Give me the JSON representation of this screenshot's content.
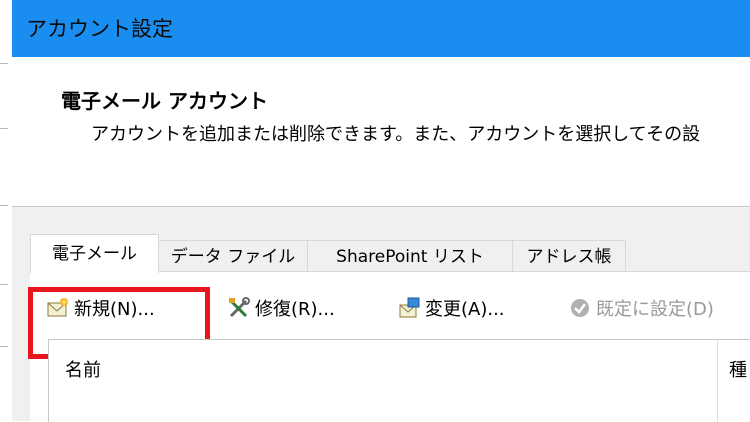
{
  "window": {
    "title": "アカウント設定"
  },
  "header": {
    "heading": "電子メール アカウント",
    "description": "アカウントを追加または削除できます。また、アカウントを選択してその設"
  },
  "tabs": [
    {
      "label": "電子メール",
      "active": true
    },
    {
      "label": "データ ファイル",
      "active": false
    },
    {
      "label": "SharePoint リスト",
      "active": false
    },
    {
      "label": "アドレス帳",
      "active": false
    }
  ],
  "toolbar": {
    "new_label": "新規(N)...",
    "repair_label": "修復(R)...",
    "change_label": "変更(A)...",
    "set_default_label": "既定に設定(D)"
  },
  "list": {
    "columns": [
      "名前",
      "種"
    ]
  },
  "colors": {
    "titlebar": "#1a8ef0",
    "highlight": "#e6161c"
  }
}
